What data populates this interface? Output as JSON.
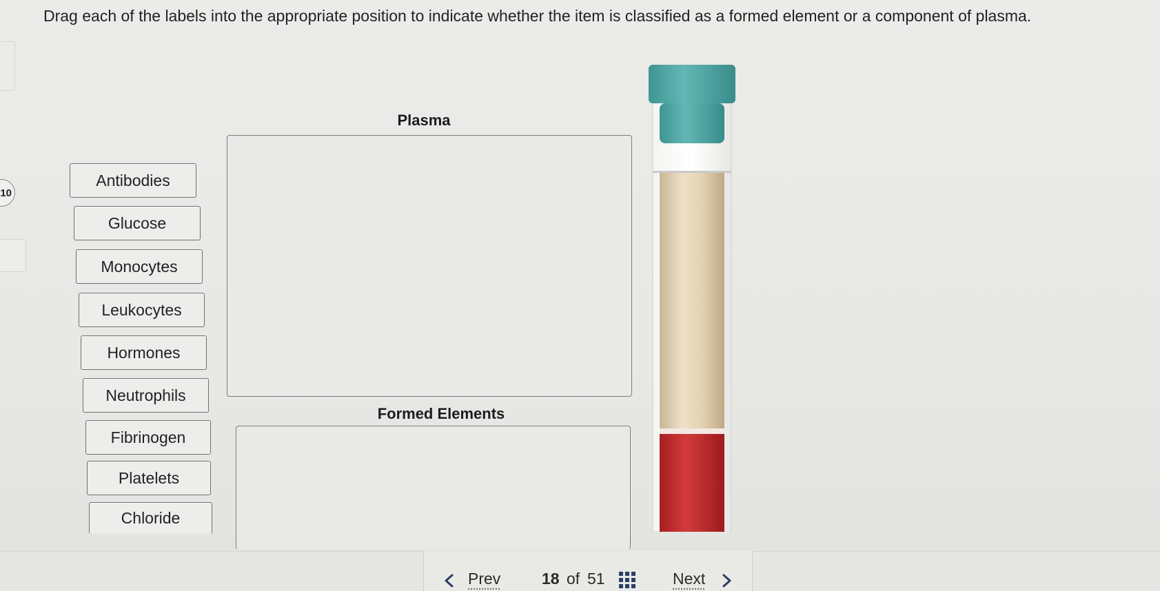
{
  "instructions": "Drag each of the labels into the appropriate position to indicate whether the item is classified as a formed element or a component of plasma.",
  "side_badge": "10",
  "labels": [
    {
      "text": "Antibodies"
    },
    {
      "text": "Glucose"
    },
    {
      "text": "Monocytes"
    },
    {
      "text": "Leukocytes"
    },
    {
      "text": "Hormones"
    },
    {
      "text": "Neutrophils"
    },
    {
      "text": "Fibrinogen"
    },
    {
      "text": "Platelets"
    },
    {
      "text": "Chloride"
    }
  ],
  "zones": {
    "plasma_title": "Plasma",
    "formed_title": "Formed Elements"
  },
  "tube": {
    "cap_color": "#4fa8a6",
    "plasma_color": "#d9c9b0",
    "cells_color": "#c0282c"
  },
  "nav": {
    "prev": "Prev",
    "current": "18",
    "of": "of",
    "total": "51",
    "next": "Next"
  },
  "icons": {
    "prev": "chevron-left-icon",
    "next": "chevron-right-icon",
    "grid": "grid-icon"
  }
}
